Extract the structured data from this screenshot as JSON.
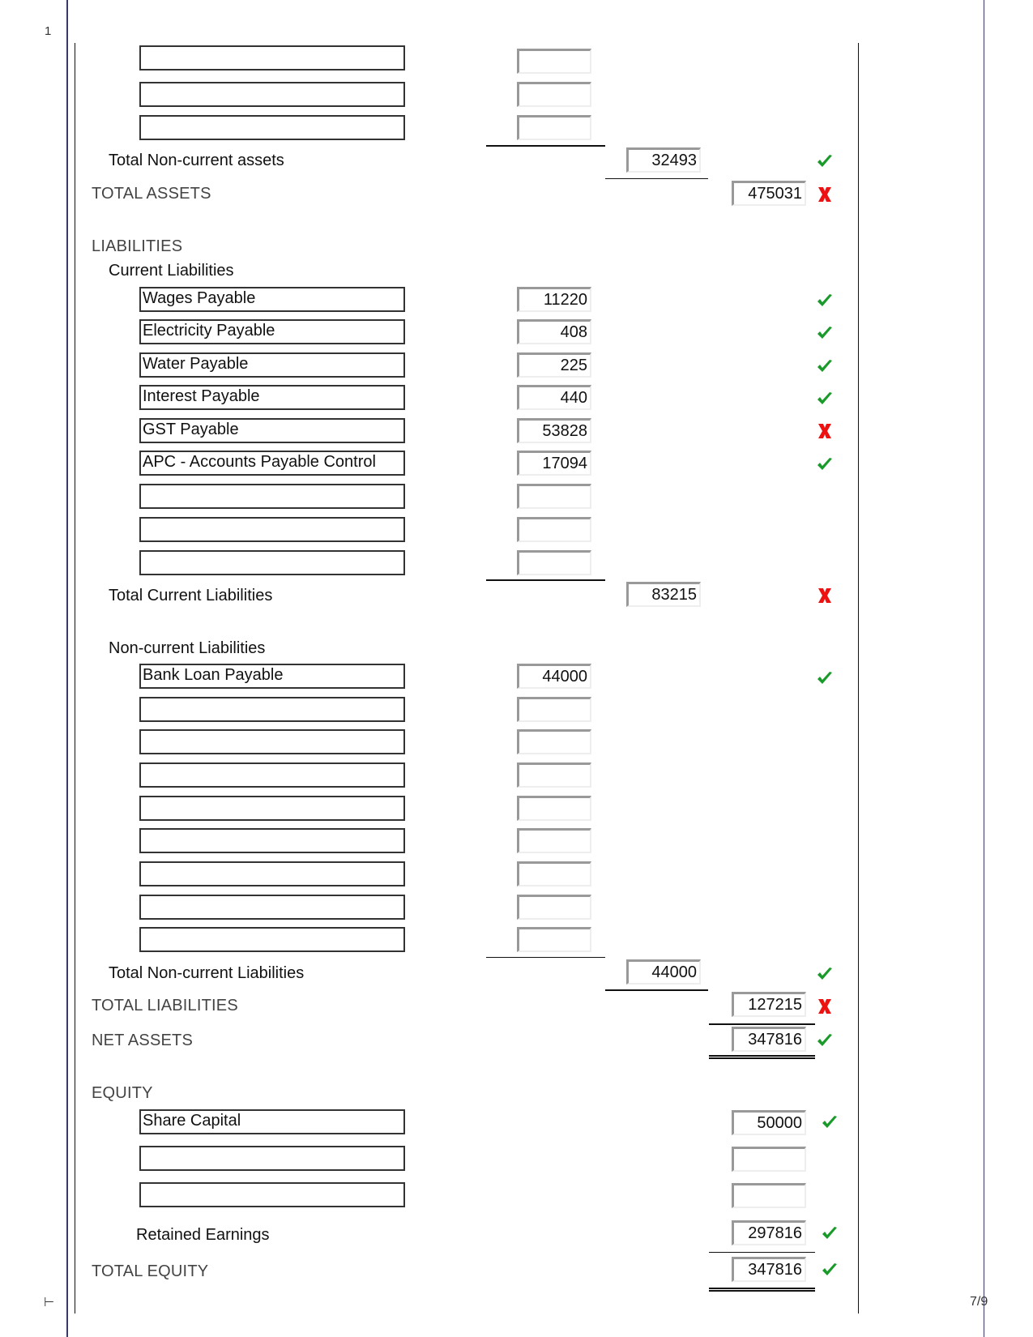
{
  "page": {
    "margin_marker_top": "1",
    "margin_marker_bottom": "⊢",
    "page_number": "7/9"
  },
  "colors": {
    "correct": "#1a9a2a",
    "incorrect": "#ee1111",
    "frame": "#3a3a6a"
  },
  "noncurrent_assets": {
    "rows": [
      {
        "account": "",
        "amount": ""
      },
      {
        "account": "",
        "amount": ""
      },
      {
        "account": "",
        "amount": ""
      }
    ],
    "total_label": "Total Non-current assets",
    "total_value": "32493",
    "total_status": "correct"
  },
  "total_assets": {
    "label": "TOTAL ASSETS",
    "value": "475031",
    "status": "incorrect"
  },
  "liabilities": {
    "heading": "LIABILITIES",
    "current": {
      "heading": "Current Liabilities",
      "rows": [
        {
          "account": "Wages Payable",
          "amount": "11220",
          "status": "correct"
        },
        {
          "account": "Electricity Payable",
          "amount": "408",
          "status": "correct"
        },
        {
          "account": "Water Payable",
          "amount": "225",
          "status": "correct"
        },
        {
          "account": "Interest Payable",
          "amount": "440",
          "status": "correct"
        },
        {
          "account": "GST Payable",
          "amount": "53828",
          "status": "incorrect"
        },
        {
          "account": "APC - Accounts Payable Control",
          "amount": "17094",
          "status": "correct"
        },
        {
          "account": "",
          "amount": ""
        },
        {
          "account": "",
          "amount": ""
        },
        {
          "account": "",
          "amount": ""
        }
      ],
      "total_label": "Total Current Liabilities",
      "total_value": "83215",
      "total_status": "incorrect"
    },
    "noncurrent": {
      "heading": "Non-current Liabilities",
      "rows": [
        {
          "account": "Bank Loan Payable",
          "amount": "44000",
          "status": "correct"
        },
        {
          "account": "",
          "amount": ""
        },
        {
          "account": "",
          "amount": ""
        },
        {
          "account": "",
          "amount": ""
        },
        {
          "account": "",
          "amount": ""
        },
        {
          "account": "",
          "amount": ""
        },
        {
          "account": "",
          "amount": ""
        },
        {
          "account": "",
          "amount": ""
        },
        {
          "account": "",
          "amount": ""
        }
      ],
      "total_label": "Total Non-current Liabilities",
      "total_value": "44000",
      "total_status": "correct"
    },
    "total_label": "TOTAL LIABILITIES",
    "total_value": "127215",
    "total_status": "incorrect"
  },
  "net_assets": {
    "label": "NET ASSETS",
    "value": "347816",
    "status": "correct"
  },
  "equity": {
    "heading": "EQUITY",
    "rows": [
      {
        "account": "Share Capital",
        "amount": "50000",
        "status": "correct"
      },
      {
        "account": "",
        "amount": ""
      },
      {
        "account": "",
        "amount": ""
      }
    ],
    "retained_label": "Retained Earnings",
    "retained_value": "297816",
    "retained_status": "correct",
    "total_label": "TOTAL EQUITY",
    "total_value": "347816",
    "total_status": "correct"
  }
}
